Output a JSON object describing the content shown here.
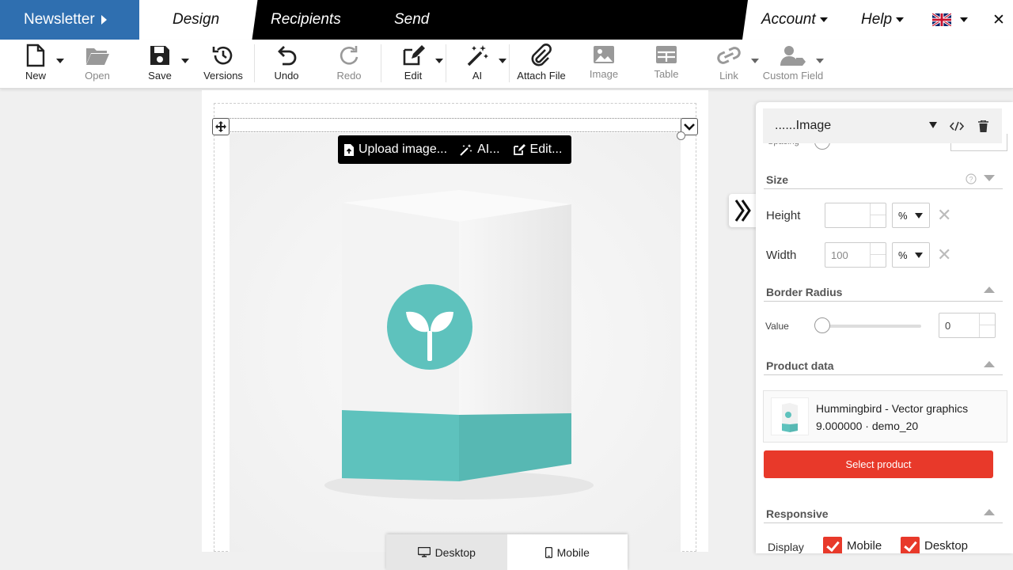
{
  "topnav": {
    "brand": "Newsletter",
    "tabs": [
      "Design",
      "Recipients",
      "Send"
    ],
    "account": "Account",
    "help": "Help",
    "close": "✕"
  },
  "toolbar": {
    "new": "New",
    "open": "Open",
    "save": "Save",
    "versions": "Versions",
    "undo": "Undo",
    "redo": "Redo",
    "edit": "Edit",
    "ai": "AI",
    "attach": "Attach File",
    "image": "Image",
    "table": "Table",
    "link": "Link",
    "custom_field": "Custom Field"
  },
  "image_toolbar": {
    "upload": "Upload image...",
    "ai": "AI...",
    "edit": "Edit..."
  },
  "device": {
    "desktop": "Desktop",
    "mobile": "Mobile",
    "active": "desktop"
  },
  "panel": {
    "title": "......Image",
    "partial_label": "Spacing",
    "size": {
      "title": "Size",
      "height_label": "Height",
      "height_value": "",
      "height_unit": "%",
      "width_label": "Width",
      "width_value": "100",
      "width_unit": "%"
    },
    "border_radius": {
      "title": "Border Radius",
      "value_label": "Value",
      "value": "0",
      "level": 0
    },
    "product_data": {
      "title": "Product data",
      "name": "Hummingbird - Vector graphics",
      "price_ref": "9.000000 · demo_20",
      "select_button": "Select product"
    },
    "responsive": {
      "title": "Responsive",
      "display_label": "Display",
      "mobile": "Mobile",
      "desktop": "Desktop",
      "mobile_checked": true,
      "desktop_checked": true
    }
  },
  "colors": {
    "brand_blue": "#2f6fb0",
    "accent_red": "#e8392a",
    "teal": "#5ec2bd"
  }
}
